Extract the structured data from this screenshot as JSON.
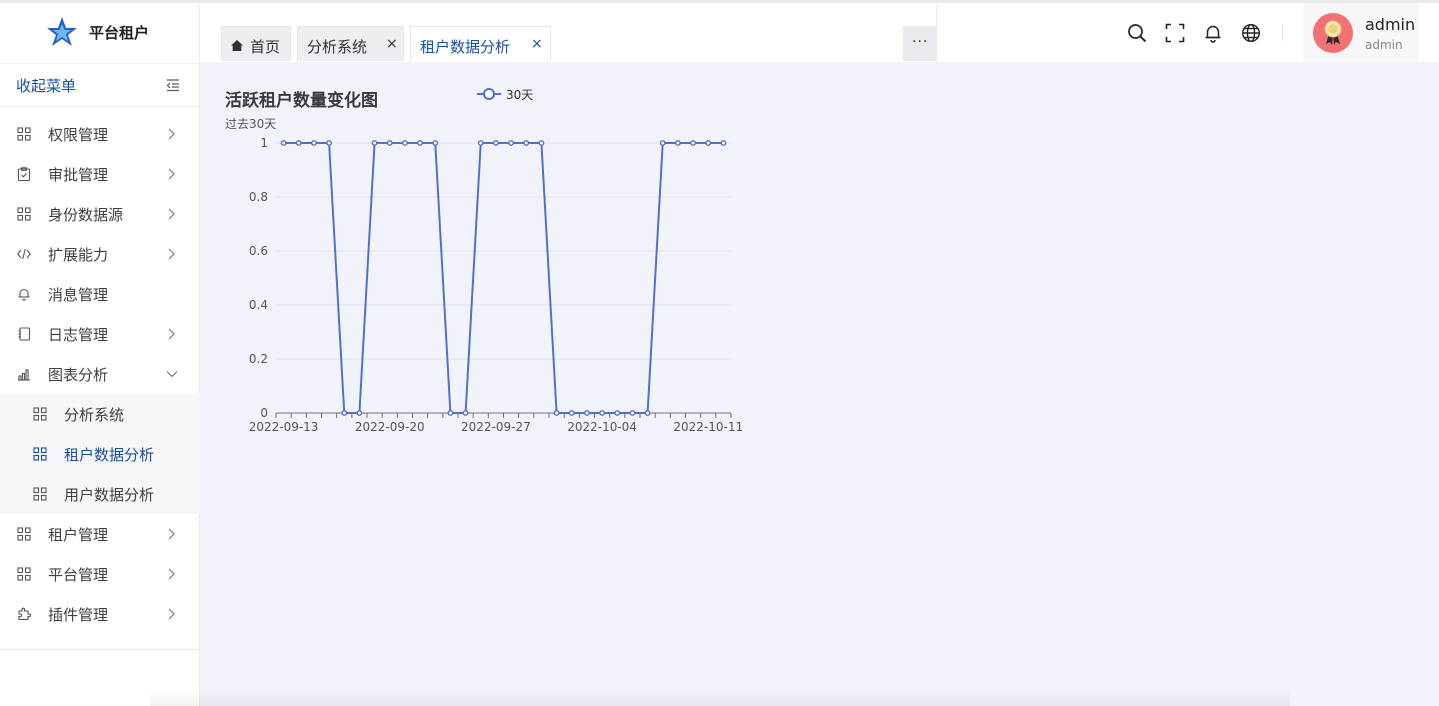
{
  "app": {
    "name": "平台租户"
  },
  "sidebar": {
    "collapse_label": "收起菜单",
    "items": [
      {
        "label": "权限管理",
        "icon": "grid-icon",
        "has_arrow": true
      },
      {
        "label": "审批管理",
        "icon": "clipboard-icon",
        "has_arrow": true
      },
      {
        "label": "身份数据源",
        "icon": "grid-icon",
        "has_arrow": true
      },
      {
        "label": "扩展能力",
        "icon": "code-icon",
        "has_arrow": true
      },
      {
        "label": "消息管理",
        "icon": "bell-icon",
        "has_arrow": false
      },
      {
        "label": "日志管理",
        "icon": "notebook-icon",
        "has_arrow": true
      },
      {
        "label": "图表分析",
        "icon": "bar-chart-icon",
        "expanded": true
      }
    ],
    "sub_items": [
      {
        "label": "分析系统",
        "icon": "grid-icon"
      },
      {
        "label": "租户数据分析",
        "icon": "grid-icon",
        "active": true
      },
      {
        "label": "用户数据分析",
        "icon": "grid-icon"
      }
    ],
    "items_after": [
      {
        "label": "租户管理",
        "icon": "grid-icon",
        "has_arrow": true
      },
      {
        "label": "平台管理",
        "icon": "grid-icon",
        "has_arrow": true
      },
      {
        "label": "插件管理",
        "icon": "plugin-icon",
        "has_arrow": true
      }
    ]
  },
  "tabs": [
    {
      "label": "首页",
      "icon": "home-icon",
      "closable": false
    },
    {
      "label": "分析系统",
      "closable": true
    },
    {
      "label": "租户数据分析",
      "closable": true,
      "active": true
    }
  ],
  "tab_close_glyph": "×",
  "more_glyph": "···",
  "header": {
    "icons": [
      "search-icon",
      "fullscreen-icon",
      "bell-icon",
      "globe-icon"
    ],
    "user": {
      "name": "admin",
      "role": "admin"
    }
  },
  "colors": {
    "accent": "#1a4fa0",
    "series": "#5470c6",
    "avatar_bg": "#f37173"
  },
  "chart_data": {
    "type": "line",
    "title": "活跃租户数量变化图",
    "subtitle": "过去30天",
    "legend": {
      "position": "top",
      "entries": [
        "30天"
      ]
    },
    "x_ticks": [
      "2022-09-13",
      "2022-09-20",
      "2022-09-27",
      "2022-10-04",
      "2022-10-11"
    ],
    "y_ticks": [
      "0",
      "0.2",
      "0.4",
      "0.6",
      "0.8",
      "1"
    ],
    "ylim": [
      0,
      1
    ],
    "grid": true,
    "x": [
      "2022-09-13",
      "2022-09-14",
      "2022-09-15",
      "2022-09-16",
      "2022-09-17",
      "2022-09-18",
      "2022-09-19",
      "2022-09-20",
      "2022-09-21",
      "2022-09-22",
      "2022-09-23",
      "2022-09-24",
      "2022-09-25",
      "2022-09-26",
      "2022-09-27",
      "2022-09-28",
      "2022-09-29",
      "2022-09-30",
      "2022-10-01",
      "2022-10-02",
      "2022-10-03",
      "2022-10-04",
      "2022-10-05",
      "2022-10-06",
      "2022-10-07",
      "2022-10-08",
      "2022-10-09",
      "2022-10-10",
      "2022-10-11",
      "2022-10-12"
    ],
    "series": [
      {
        "name": "30天",
        "values": [
          1,
          1,
          1,
          1,
          0,
          0,
          1,
          1,
          1,
          1,
          1,
          0,
          0,
          1,
          1,
          1,
          1,
          1,
          0,
          0,
          0,
          0,
          0,
          0,
          0,
          1,
          1,
          1,
          1,
          1
        ]
      }
    ]
  }
}
